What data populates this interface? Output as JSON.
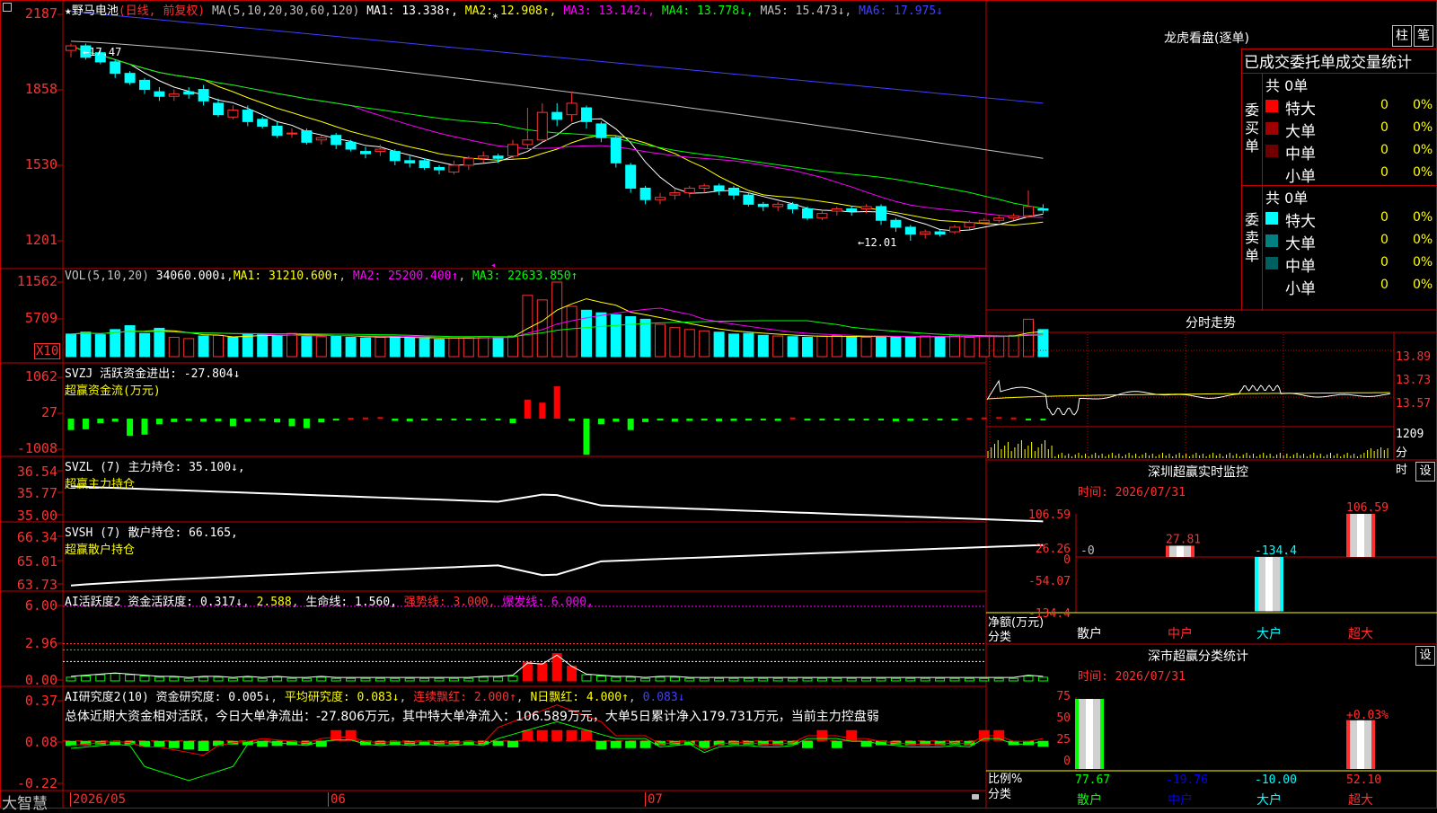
{
  "stock": {
    "name": "野马电池",
    "mode": "(日线, 前复权)",
    "star": "★"
  },
  "main_header": {
    "params": "MA(5,10,20,30,60,120)",
    "items": [
      {
        "label": "MA1: 13.338↑",
        "color": "#ffffff"
      },
      {
        "label": "MA2: 12.908↑",
        "color": "#ffff00"
      },
      {
        "label": "MA3: 13.142↓",
        "color": "#ff00ff"
      },
      {
        "label": "MA4: 13.778↓",
        "color": "#00ff00"
      },
      {
        "label": "MA5: 15.473↓",
        "color": "#c0c0c0"
      },
      {
        "label": "MA6: 17.975↓",
        "color": "#4040ff"
      }
    ],
    "high_mark": "17.47",
    "low_mark": "12.01"
  },
  "price_axis": [
    "2187",
    "1858",
    "1530",
    "1201"
  ],
  "vol_header": {
    "label": "VOL(5,10,20)",
    "value": "34060.000↓",
    "ma1": "MA1: 31210.600↑",
    "ma2": "MA2: 25200.400↑",
    "ma3": "MA3: 22633.850↑"
  },
  "vol_axis": [
    "11562",
    "5709"
  ],
  "vol_unit": "X10",
  "svzj_header": {
    "title": "SVZJ  活跃资金进出: -27.804↓",
    "sub": "超赢资金流(万元)"
  },
  "svzj_axis": [
    "1062",
    "27",
    "-1008"
  ],
  "svzl_header": {
    "title": "SVZL (7) 主力持仓: 35.100↓,",
    "sub": "超赢主力持仓"
  },
  "svzl_axis": [
    "36.54",
    "35.77",
    "35.00"
  ],
  "svsh_header": {
    "title": "SVSH (7) 散户持仓: 66.165,",
    "sub": "超赢散户持仓"
  },
  "svsh_axis": [
    "66.34",
    "65.01",
    "63.73"
  ],
  "ai2_header": {
    "title": "AI活跃度2 资金活跃度: 0.317↓",
    "v2": "2.588",
    "life": "生命线: 1.560,",
    "strong": "强势线: 3.000,",
    "burst": "爆发线: 6.000,"
  },
  "ai2_axis": [
    "6.00",
    "2.96",
    "0.00"
  ],
  "research_header": {
    "title": "AI研究度2(10) 资金研究度: 0.005↓",
    "avg": "平均研究度: 0.083↓",
    "cont": "连续飘红: 2.000↑",
    "nday": "N日飘红: 4.000↑",
    "last": "0.083↓"
  },
  "research_axis": [
    "0.37",
    "0.08",
    "-0.22"
  ],
  "summary": "总体近期大资金相对活跃，今日大单净流出：-27.806万元，其中特大单净流入：106.589万元，大单5日累计净入179.731万元，当前主力控盘弱",
  "bottom": {
    "brand": "大智慧",
    "dates": [
      "2026/05",
      "06",
      "07"
    ]
  },
  "right": {
    "title": "龙虎看盘(逐单)",
    "btn_column": "柱",
    "btn_pen": "笔",
    "stats_title": "已成交委托单成交量统计",
    "buy_label": "委买单",
    "sell_label": "委卖单",
    "buy_total": "共 0单",
    "sell_total": "共 0单",
    "buy_rows": [
      {
        "name": "特大",
        "val": "0",
        "pct": "0%",
        "color": "#ff0000"
      },
      {
        "name": "大单",
        "val": "0",
        "pct": "0%",
        "color": "#a00000"
      },
      {
        "name": "中单",
        "val": "0",
        "pct": "0%",
        "color": "#700000"
      },
      {
        "name": "小单",
        "val": "0",
        "pct": "0%",
        "color": ""
      }
    ],
    "sell_rows": [
      {
        "name": "特大",
        "val": "0",
        "pct": "0%",
        "color": "#00ffff"
      },
      {
        "name": "大单",
        "val": "0",
        "pct": "0%",
        "color": "#008080"
      },
      {
        "name": "中单",
        "val": "0",
        "pct": "0%",
        "color": "#006060"
      },
      {
        "name": "小单",
        "val": "0",
        "pct": "0%",
        "color": ""
      }
    ],
    "intraday_title": "分时走势",
    "intraday_axis": [
      "13.89",
      "13.73",
      "13.57"
    ],
    "intraday_vol": "1209",
    "intraday_vol_unit": "分时",
    "monitor_title": "深圳超赢实时监控",
    "monitor_setting": "设",
    "monitor_time": "时间: 2026/07/31",
    "monitor_axis": [
      "106.59",
      "26.26",
      "0",
      "-54.07",
      "-134.4"
    ],
    "monitor_unit": "净额(万元)",
    "monitor_class": "分类",
    "monitor_bars": [
      {
        "cat": "散户",
        "value": "-0",
        "color": "#c0c0c0"
      },
      {
        "cat": "中户",
        "value": "27.81",
        "color": "#ff3030"
      },
      {
        "cat": "大户",
        "value": "-134.4",
        "color": "#00ffff"
      },
      {
        "cat": "超大",
        "value": "106.59",
        "color": "#ff3030"
      }
    ],
    "class_title": "深市超赢分类统计",
    "class_setting": "设",
    "class_time": "时间: 2026/07/31",
    "class_axis": [
      "75",
      "50",
      "25",
      "0"
    ],
    "class_ratio": "比例%",
    "class_class": "分类",
    "class_bars": [
      {
        "cat": "散户",
        "value": "77.67",
        "color": "#00ff00"
      },
      {
        "cat": "中户",
        "value": "-19.76",
        "color": "#0000ff"
      },
      {
        "cat": "大户",
        "value": "-10.00",
        "color": "#00ffff"
      },
      {
        "cat": "超大",
        "value": "52.10",
        "color": "#ff3030"
      }
    ],
    "class_change": "+0.03%"
  },
  "chart_data": [
    {
      "type": "candlestick",
      "title": "野马电池 (日线, 前复权)",
      "note": "approximate daily OHLC estimated from the price pane (axis labels 2187=21.87)",
      "ylim": [
        11.8,
        22.1
      ],
      "candles": [
        [
          20.3,
          20.5,
          20.0,
          20.6
        ],
        [
          20.5,
          20.0,
          19.9,
          20.6
        ],
        [
          20.2,
          19.8,
          19.7,
          20.4
        ],
        [
          19.8,
          19.3,
          19.1,
          19.9
        ],
        [
          19.3,
          18.9,
          18.8,
          19.4
        ],
        [
          19.0,
          18.6,
          18.4,
          19.1
        ],
        [
          18.5,
          18.3,
          18.1,
          18.7
        ],
        [
          18.3,
          18.4,
          18.1,
          18.6
        ],
        [
          18.5,
          18.4,
          18.2,
          18.7
        ],
        [
          18.6,
          18.1,
          17.9,
          18.8
        ],
        [
          18.0,
          17.5,
          17.4,
          18.2
        ],
        [
          17.4,
          17.7,
          17.3,
          17.9
        ],
        [
          17.7,
          17.2,
          17.0,
          17.9
        ],
        [
          17.3,
          17.0,
          16.9,
          17.4
        ],
        [
          17.0,
          16.6,
          16.5,
          17.2
        ],
        [
          16.7,
          16.7,
          16.5,
          16.9
        ],
        [
          16.8,
          16.3,
          16.2,
          16.9
        ],
        [
          16.4,
          16.5,
          16.2,
          16.6
        ],
        [
          16.6,
          16.2,
          16.0,
          16.7
        ],
        [
          16.3,
          16.0,
          15.9,
          16.4
        ],
        [
          15.9,
          15.8,
          15.6,
          16.1
        ],
        [
          15.9,
          16.0,
          15.7,
          16.2
        ],
        [
          15.9,
          15.5,
          15.3,
          16.0
        ],
        [
          15.5,
          15.4,
          15.2,
          15.7
        ],
        [
          15.5,
          15.2,
          15.1,
          15.6
        ],
        [
          15.2,
          15.1,
          14.9,
          15.3
        ],
        [
          15.0,
          15.3,
          14.9,
          15.5
        ],
        [
          15.3,
          15.6,
          15.1,
          15.7
        ],
        [
          15.6,
          15.7,
          15.4,
          15.9
        ],
        [
          15.7,
          15.6,
          15.4,
          15.8
        ],
        [
          15.7,
          16.2,
          15.6,
          16.4
        ],
        [
          16.2,
          16.4,
          16.0,
          17.8
        ],
        [
          16.4,
          17.6,
          16.3,
          18.0
        ],
        [
          17.6,
          17.3,
          17.0,
          18.0
        ],
        [
          17.5,
          18.0,
          17.2,
          18.5
        ],
        [
          17.8,
          17.2,
          16.9,
          17.9
        ],
        [
          17.1,
          16.5,
          16.3,
          17.2
        ],
        [
          16.5,
          15.4,
          15.2,
          16.6
        ],
        [
          15.3,
          14.3,
          14.1,
          15.4
        ],
        [
          14.3,
          13.8,
          13.6,
          14.4
        ],
        [
          13.8,
          13.9,
          13.6,
          14.1
        ],
        [
          14.0,
          14.1,
          13.8,
          14.3
        ],
        [
          14.1,
          14.3,
          13.9,
          14.4
        ],
        [
          14.3,
          14.4,
          14.1,
          14.5
        ],
        [
          14.4,
          14.2,
          14.0,
          14.5
        ],
        [
          14.3,
          14.0,
          13.8,
          14.4
        ],
        [
          14.0,
          13.6,
          13.5,
          14.1
        ],
        [
          13.6,
          13.5,
          13.3,
          13.7
        ],
        [
          13.5,
          13.6,
          13.3,
          13.7
        ],
        [
          13.6,
          13.4,
          13.2,
          13.7
        ],
        [
          13.4,
          13.0,
          12.9,
          13.5
        ],
        [
          13.0,
          13.2,
          12.9,
          13.3
        ],
        [
          13.3,
          13.4,
          13.1,
          13.5
        ],
        [
          13.4,
          13.3,
          13.1,
          13.5
        ],
        [
          13.4,
          13.5,
          13.2,
          13.6
        ],
        [
          13.5,
          12.9,
          12.7,
          13.6
        ],
        [
          12.9,
          12.6,
          12.4,
          13.0
        ],
        [
          12.6,
          12.3,
          12.01,
          12.7
        ],
        [
          12.3,
          12.4,
          12.1,
          12.5
        ],
        [
          12.4,
          12.3,
          12.2,
          12.5
        ],
        [
          12.4,
          12.6,
          12.3,
          12.7
        ],
        [
          12.6,
          12.8,
          12.5,
          12.9
        ],
        [
          12.8,
          12.9,
          12.7,
          13.0
        ],
        [
          12.9,
          13.0,
          12.8,
          13.1
        ],
        [
          13.0,
          13.1,
          12.9,
          13.2
        ],
        [
          13.1,
          13.5,
          13.0,
          14.2
        ],
        [
          13.4,
          13.34,
          13.2,
          13.6
        ]
      ]
    },
    {
      "type": "bar",
      "title": "VOL(5,10,20)",
      "ylim": [
        0,
        13000
      ],
      "values": [
        3500,
        3800,
        3400,
        4200,
        4800,
        3600,
        4400,
        3000,
        2800,
        3200,
        3300,
        3000,
        3500,
        3400,
        3200,
        3600,
        3300,
        3100,
        3200,
        3000,
        2900,
        3000,
        3100,
        2900,
        2800,
        2700,
        2900,
        3000,
        3100,
        3000,
        3200,
        9500,
        8800,
        11562,
        7800,
        7200,
        6800,
        6500,
        6200,
        5800,
        5000,
        4500,
        4200,
        4000,
        3800,
        3500,
        3600,
        3300,
        3200,
        3100,
        3000,
        3200,
        3300,
        3100,
        3000,
        3200,
        3100,
        3000,
        3200,
        3100,
        3300,
        3000,
        3200,
        3100,
        3300,
        5800,
        4200
      ],
      "up": [
        0,
        0,
        0,
        0,
        0,
        0,
        0,
        1,
        1,
        0,
        1,
        0,
        0,
        0,
        0,
        1,
        0,
        1,
        0,
        0,
        0,
        1,
        0,
        0,
        0,
        0,
        1,
        1,
        1,
        0,
        1,
        1,
        1,
        1,
        1,
        0,
        0,
        0,
        0,
        0,
        1,
        1,
        1,
        1,
        0,
        0,
        0,
        0,
        1,
        0,
        0,
        1,
        1,
        0,
        1,
        0,
        0,
        0,
        1,
        0,
        1,
        1,
        1,
        1,
        1,
        1,
        0
      ]
    },
    {
      "type": "bar",
      "title": "SVZJ 活跃资金进出",
      "ylim": [
        -1008,
        1062
      ],
      "values": [
        -300,
        -280,
        -120,
        -80,
        -450,
        -420,
        -150,
        -90,
        -60,
        -80,
        -70,
        -200,
        -80,
        -60,
        -100,
        -200,
        -250,
        -100,
        -50,
        20,
        30,
        40,
        -60,
        -70,
        -50,
        -30,
        -40,
        -30,
        -20,
        -30,
        -120,
        500,
        420,
        850,
        -60,
        -950,
        -150,
        -80,
        -300,
        -90,
        -50,
        -80,
        -60,
        -50,
        -70,
        -60,
        -50,
        -40,
        -60,
        30,
        -50,
        -40,
        -30,
        -50,
        -30,
        -40,
        -70,
        -60,
        -30,
        -40,
        -50,
        20,
        30,
        40,
        30,
        -27.8,
        -20
      ],
      "current": -27.804
    },
    {
      "type": "line",
      "title": "SVZL (7) 主力持仓",
      "ylim": [
        35.0,
        36.6
      ],
      "current": 35.1
    },
    {
      "type": "line",
      "title": "SVSH (7) 散户持仓",
      "ylim": [
        63.7,
        66.4
      ],
      "current": 66.165
    },
    {
      "type": "bar",
      "title": "AI活跃度2 资金活跃度",
      "ylim": [
        0,
        6.3
      ],
      "current": 0.317,
      "life_line": 1.56,
      "strong_line": 3.0,
      "burst_line": 6.0
    },
    {
      "type": "bar",
      "title": "AI研究度2(10) 资金研究度",
      "ylim": [
        -0.22,
        0.37
      ],
      "current": 0.005,
      "average": 0.083
    },
    {
      "type": "bar",
      "title": "深圳超赢实时监控",
      "categories": [
        "散户",
        "中户",
        "大户",
        "超大"
      ],
      "values": [
        0,
        27.81,
        -134.4,
        106.59
      ],
      "ylim": [
        -134.4,
        106.59
      ],
      "ylabel": "净额(万元)"
    },
    {
      "type": "bar",
      "title": "深市超赢分类统计",
      "categories": [
        "散户",
        "中户",
        "大户",
        "超大"
      ],
      "values": [
        77.67,
        -19.76,
        -10.0,
        52.1
      ],
      "ylim": [
        0,
        75
      ],
      "ylabel": "比例%"
    }
  ]
}
